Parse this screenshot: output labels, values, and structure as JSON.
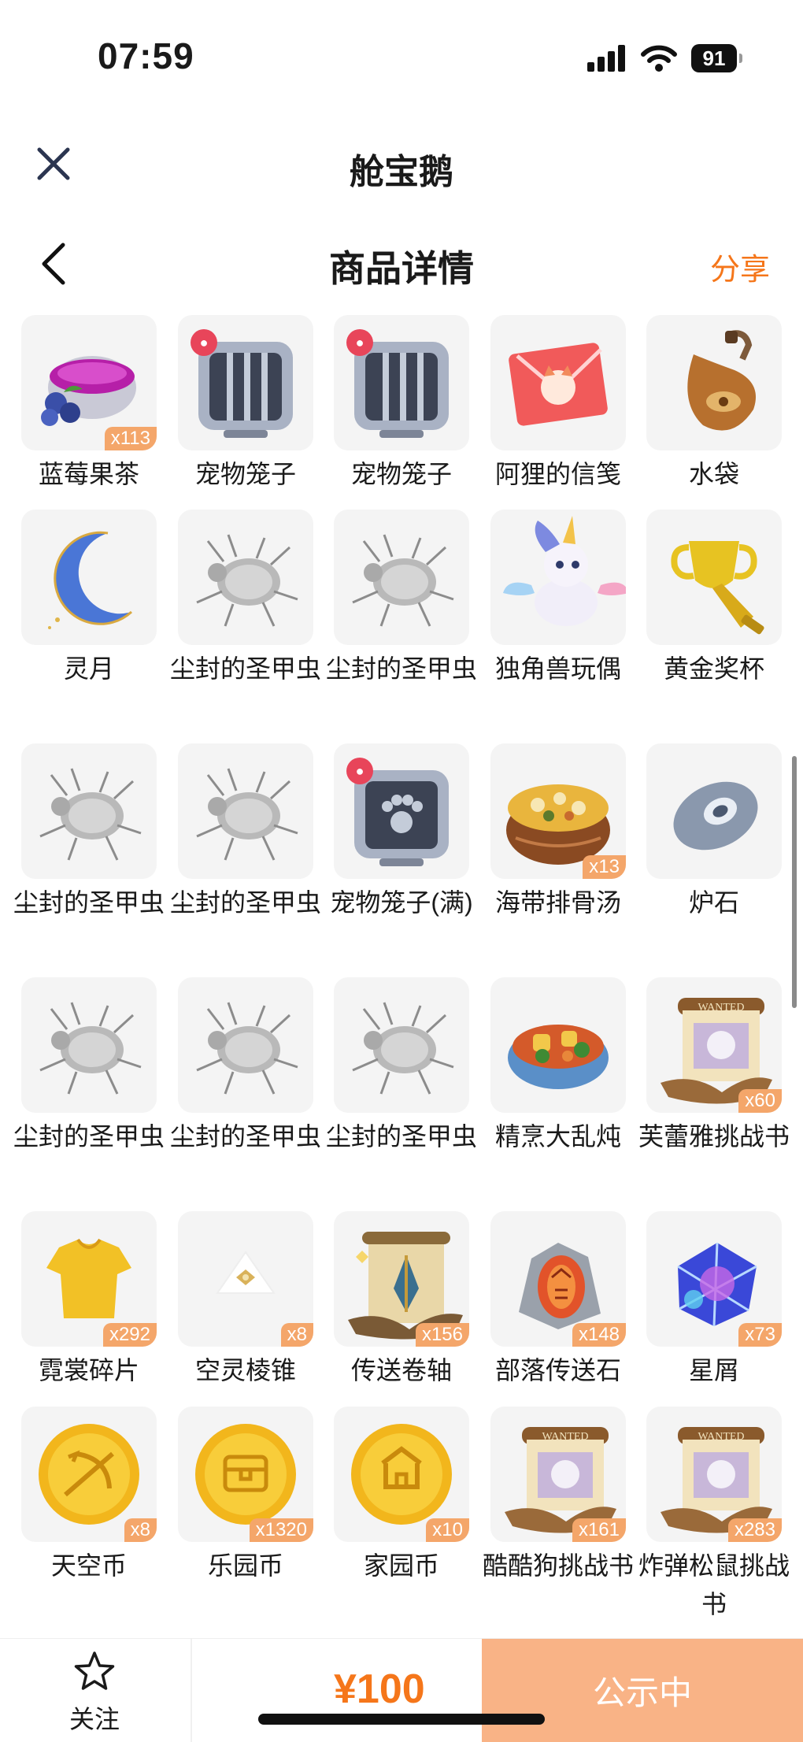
{
  "status_bar": {
    "time": "07:59",
    "battery": "91"
  },
  "app": {
    "title": "舱宝鹅"
  },
  "nav": {
    "title": "商品详情",
    "share_label": "分享"
  },
  "items": [
    {
      "name": "蓝莓果茶",
      "qty": "x113",
      "icon": "blueberry-tea-icon"
    },
    {
      "name": "宠物笼子",
      "qty": "",
      "icon": "pet-cage-icon"
    },
    {
      "name": "宠物笼子",
      "qty": "",
      "icon": "pet-cage-icon"
    },
    {
      "name": "阿狸的信笺",
      "qty": "",
      "icon": "letter-icon"
    },
    {
      "name": "水袋",
      "qty": "",
      "icon": "water-bag-icon"
    },
    {
      "name": "灵月",
      "qty": "",
      "icon": "moon-icon"
    },
    {
      "name": "尘封的圣甲虫",
      "qty": "",
      "icon": "scarab-icon"
    },
    {
      "name": "尘封的圣甲虫",
      "qty": "",
      "icon": "scarab-icon"
    },
    {
      "name": "独角兽玩偶",
      "qty": "",
      "icon": "unicorn-toy-icon"
    },
    {
      "name": "黄金奖杯",
      "qty": "",
      "icon": "trophy-icon"
    },
    {
      "name": "尘封的圣甲虫",
      "qty": "",
      "icon": "scarab-icon"
    },
    {
      "name": "尘封的圣甲虫",
      "qty": "",
      "icon": "scarab-icon"
    },
    {
      "name": "宠物笼子(满)",
      "qty": "",
      "icon": "pet-cage-full-icon"
    },
    {
      "name": "海带排骨汤",
      "qty": "x13",
      "icon": "soup-icon"
    },
    {
      "name": "炉石",
      "qty": "",
      "icon": "hearthstone-icon"
    },
    {
      "name": "尘封的圣甲虫",
      "qty": "",
      "icon": "scarab-icon"
    },
    {
      "name": "尘封的圣甲虫",
      "qty": "",
      "icon": "scarab-icon"
    },
    {
      "name": "尘封的圣甲虫",
      "qty": "",
      "icon": "scarab-icon"
    },
    {
      "name": "精烹大乱炖",
      "qty": "",
      "icon": "stew-icon"
    },
    {
      "name": "芙蕾雅挑战书",
      "qty": "x60",
      "icon": "wanted-scroll-icon"
    },
    {
      "name": "霓裳碎片",
      "qty": "x292",
      "icon": "shirt-shard-icon"
    },
    {
      "name": "空灵棱锥",
      "qty": "x8",
      "icon": "pyramid-icon"
    },
    {
      "name": "传送卷轴",
      "qty": "x156",
      "icon": "teleport-scroll-icon"
    },
    {
      "name": "部落传送石",
      "qty": "x148",
      "icon": "tribe-stone-icon"
    },
    {
      "name": "星屑",
      "qty": "x73",
      "icon": "stardust-icon"
    },
    {
      "name": "天空币",
      "qty": "x8",
      "icon": "sky-coin-icon"
    },
    {
      "name": "乐园币",
      "qty": "x1320",
      "icon": "park-coin-icon"
    },
    {
      "name": "家园币",
      "qty": "x10",
      "icon": "home-coin-icon"
    },
    {
      "name": "酷酷狗挑战书",
      "qty": "x161",
      "icon": "wanted-scroll-icon"
    },
    {
      "name": "炸弹松鼠挑战书",
      "qty": "x283",
      "icon": "wanted-scroll-icon"
    }
  ],
  "bottom_bar": {
    "follow_label": "关注",
    "price": "¥100",
    "status_label": "公示中"
  },
  "colors": {
    "accent": "#f5761a",
    "badge": "#f4a66a",
    "status_button": "#f9b386"
  }
}
